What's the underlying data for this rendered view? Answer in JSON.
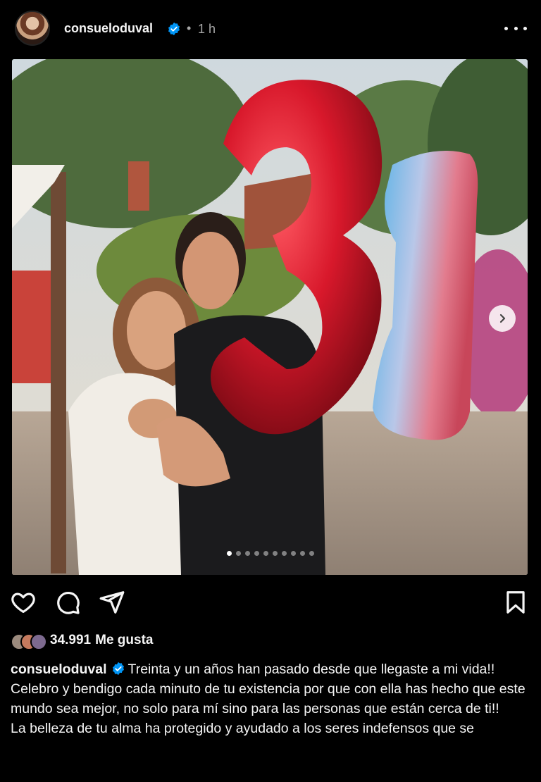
{
  "post": {
    "username": "consueloduval",
    "time_ago": "1 h",
    "separator": "•",
    "verified": true
  },
  "media": {
    "carousel_count": 10,
    "active_index": 0
  },
  "actions": {
    "like_icon": "heart-icon",
    "comment_icon": "comment-icon",
    "share_icon": "send-icon",
    "save_icon": "bookmark-icon"
  },
  "likes": {
    "count": "34.991",
    "label": "Me gusta"
  },
  "caption": {
    "username": "consueloduval",
    "line1": "Treinta y un años han pasado desde que llegaste a mi vida!!",
    "line2": "Celebro y bendigo cada minuto de tu existencia por que con ella has hecho que este mundo sea mejor, no solo para mí sino para las personas que están cerca de ti!!",
    "line3": "La belleza de tu alma ha protegido y ayudado a los seres indefensos que se"
  },
  "colors": {
    "background": "#000000",
    "text": "#f5f5f5",
    "muted": "#a8a8a8",
    "verified": "#0095f6",
    "balloon_red": "#d0182a"
  }
}
